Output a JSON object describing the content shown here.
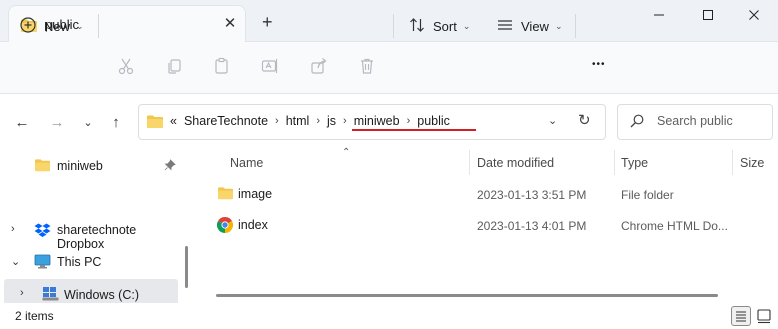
{
  "window": {
    "tab_title": "public",
    "new_tab_symbol": "+",
    "minimize": "minimize",
    "maximize": "maximize",
    "close": "close"
  },
  "toolbar": {
    "new_label": "New",
    "sort_label": "Sort",
    "view_label": "View",
    "more_label": "•••"
  },
  "address": {
    "overflow": "«",
    "crumbs": [
      "ShareTechnote",
      "html",
      "js",
      "miniweb",
      "public"
    ],
    "arrow": "›",
    "underline_color": "#d21f26"
  },
  "search": {
    "placeholder": "Search public"
  },
  "nav": {
    "items": [
      {
        "label": "miniweb",
        "icon": "folder-icon",
        "pinned": true
      },
      {
        "label": "sharetechnote Dropbox",
        "icon": "dropbox-icon",
        "expanded": false
      },
      {
        "label": "This PC",
        "icon": "pc-icon",
        "expanded": true
      },
      {
        "label": "Windows (C:)",
        "icon": "drive-icon",
        "expanded": false
      }
    ]
  },
  "columns": {
    "name": "Name",
    "date": "Date modified",
    "type": "Type",
    "size": "Size"
  },
  "files": [
    {
      "name": "image",
      "date": "2023-01-13 3:51 PM",
      "type": "File folder",
      "icon": "folder-icon"
    },
    {
      "name": "index",
      "date": "2023-01-13 4:01 PM",
      "type": "Chrome HTML Do...",
      "icon": "chrome-icon"
    }
  ],
  "status": {
    "count": "2 items"
  },
  "colors": {
    "folder": "#f3c74f",
    "accent": "#0067c0",
    "underline": "#d21f26"
  }
}
